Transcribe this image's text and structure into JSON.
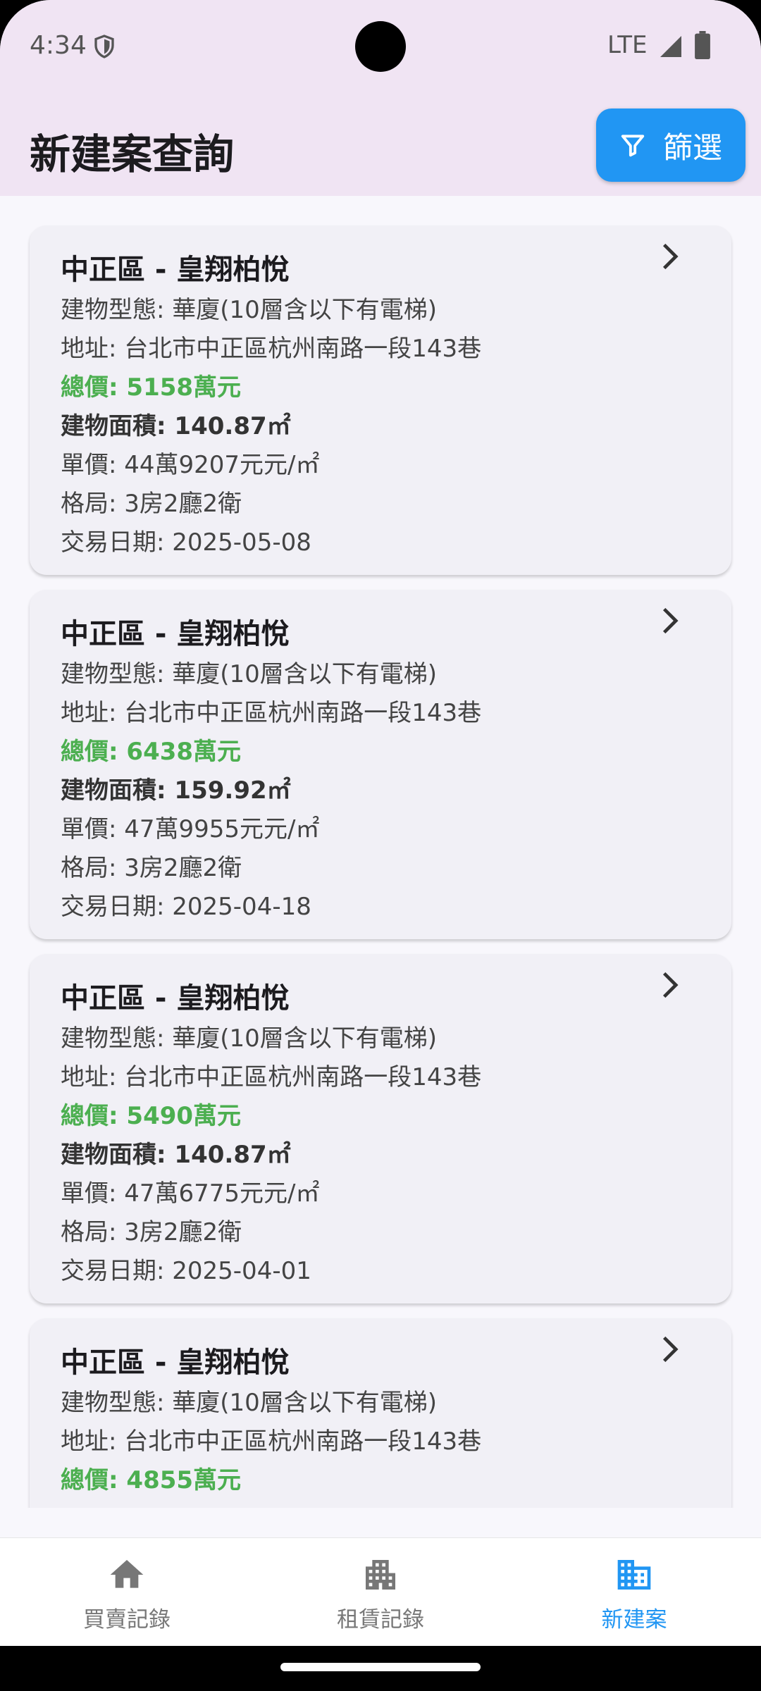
{
  "status": {
    "time": "4:34",
    "network": "LTE"
  },
  "app_bar": {
    "title": "新建案查詢",
    "filter_label": "篩選"
  },
  "listings": [
    {
      "title": "中正區 - 皇翔柏悅",
      "building_type": "建物型態: 華廈(10層含以下有電梯)",
      "address": "地址: 台北市中正區杭州南路一段143巷",
      "total_price": "總價: 5158萬元",
      "area": "建物面積: 140.87㎡",
      "unit_price": "單價: 44萬9207元元/㎡",
      "layout": "格局: 3房2廳2衛",
      "date": "交易日期: 2025-05-08"
    },
    {
      "title": "中正區 - 皇翔柏悅",
      "building_type": "建物型態: 華廈(10層含以下有電梯)",
      "address": "地址: 台北市中正區杭州南路一段143巷",
      "total_price": "總價: 6438萬元",
      "area": "建物面積: 159.92㎡",
      "unit_price": "單價: 47萬9955元元/㎡",
      "layout": "格局: 3房2廳2衛",
      "date": "交易日期: 2025-04-18"
    },
    {
      "title": "中正區 - 皇翔柏悅",
      "building_type": "建物型態: 華廈(10層含以下有電梯)",
      "address": "地址: 台北市中正區杭州南路一段143巷",
      "total_price": "總價: 5490萬元",
      "area": "建物面積: 140.87㎡",
      "unit_price": "單價: 47萬6775元元/㎡",
      "layout": "格局: 3房2廳2衛",
      "date": "交易日期: 2025-04-01"
    },
    {
      "title": "中正區 - 皇翔柏悅",
      "building_type": "建物型態: 華廈(10層含以下有電梯)",
      "address": "地址: 台北市中正區杭州南路一段143巷",
      "total_price": "總價: 4855萬元"
    }
  ],
  "bottom_nav": [
    {
      "label": "買賣記錄",
      "icon": "home-icon",
      "active": false
    },
    {
      "label": "租賃記錄",
      "icon": "apartment-icon",
      "active": false
    },
    {
      "label": "新建案",
      "icon": "business-icon",
      "active": true
    }
  ],
  "colors": {
    "accent": "#2196f3",
    "price": "#4caf50",
    "app_bar": "#f0e4f3"
  }
}
